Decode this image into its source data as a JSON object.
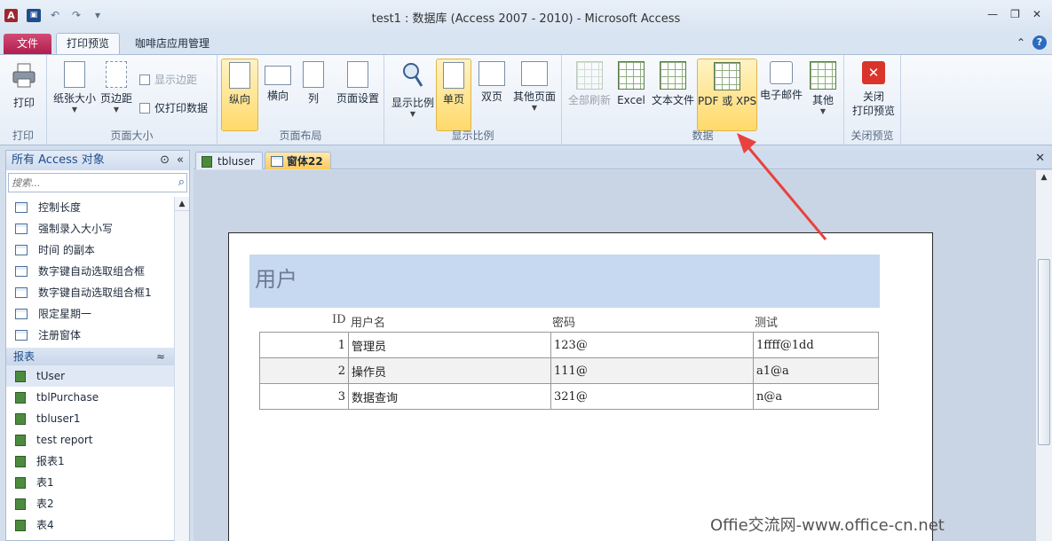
{
  "window": {
    "title": "test1 : 数据库 (Access 2007 - 2010)  -  Microsoft Access",
    "app_letter": "A"
  },
  "ribbon_tabs": {
    "file": "文件",
    "print_preview": "打印预览",
    "cafe": "咖啡店应用管理"
  },
  "ribbon": {
    "print_group": {
      "label": "打印",
      "print": "打印"
    },
    "size_group": {
      "label": "页面大小",
      "paper_size": "纸张大小",
      "margins": "页边距",
      "show_margins": "显示边距",
      "print_data_only": "仅打印数据"
    },
    "layout_group": {
      "label": "页面布局",
      "portrait": "纵向",
      "landscape": "横向",
      "columns": "列",
      "page_setup": "页面设置"
    },
    "zoom_group": {
      "label": "显示比例",
      "zoom": "显示比例",
      "one_page": "单页",
      "two_pages": "双页",
      "more_pages": "其他页面"
    },
    "data_group": {
      "label": "数据",
      "refresh_all": "全部刷新",
      "excel": "Excel",
      "text_file": "文本文件",
      "pdf_xps": "PDF 或 XPS",
      "email": "电子邮件",
      "more": "其他"
    },
    "close_group": {
      "label": "关闭预览",
      "close_line1": "关闭",
      "close_line2": "打印预览"
    }
  },
  "nav": {
    "header": "所有 Access 对象",
    "search_placeholder": "搜索...",
    "forms": [
      {
        "label": "控制长度"
      },
      {
        "label": "强制录入大小写"
      },
      {
        "label": "时间 的副本"
      },
      {
        "label": "数字键自动选取组合框"
      },
      {
        "label": "数字键自动选取组合框1"
      },
      {
        "label": "限定星期一"
      },
      {
        "label": "注册窗体"
      }
    ],
    "reports_section": "报表",
    "reports": [
      {
        "label": "tUser"
      },
      {
        "label": "tblPurchase"
      },
      {
        "label": "tbluser1"
      },
      {
        "label": "test report"
      },
      {
        "label": "报表1"
      },
      {
        "label": "表1"
      },
      {
        "label": "表2"
      },
      {
        "label": "表4"
      }
    ]
  },
  "doc_tabs": {
    "tab1": "tbluser",
    "tab2": "窗体22"
  },
  "form": {
    "title": "用户",
    "headers": {
      "id": "ID",
      "username": "用户名",
      "password": "密码",
      "test": "测试"
    },
    "rows": [
      {
        "id": "1",
        "username": "管理员",
        "password": "123@",
        "test": "1ffff@1dd"
      },
      {
        "id": "2",
        "username": "操作员",
        "password": "111@",
        "test": "a1@a"
      },
      {
        "id": "3",
        "username": "数据查询",
        "password": "321@",
        "test": "n@a"
      }
    ]
  },
  "watermark": "Offie交流网-www.office-cn.net",
  "colors": {
    "accent": "#ffd96a",
    "file_tab": "#b01e4e",
    "form_header": "#c6d9f0",
    "arrow": "#e8423f"
  }
}
